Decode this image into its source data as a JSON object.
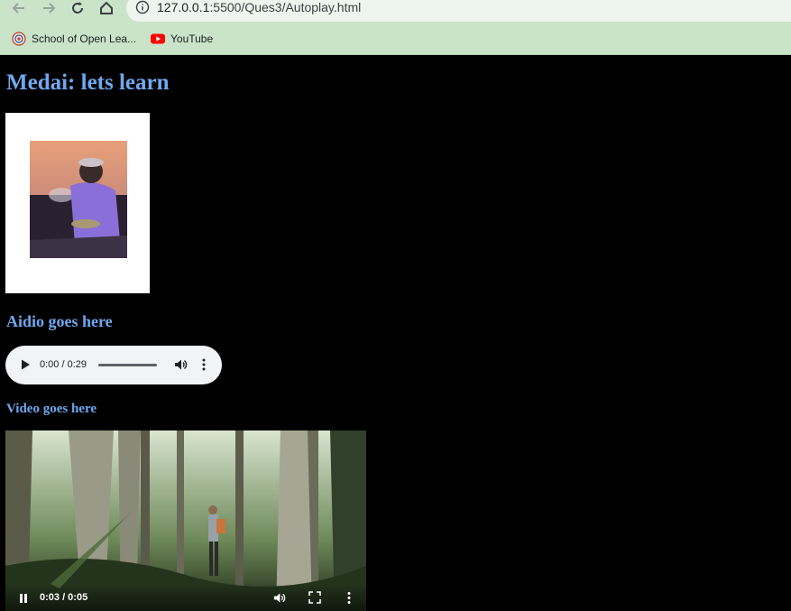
{
  "browser": {
    "url_host": "127.0.0.1",
    "url_path": ":5500/Ques3/Autoplay.html",
    "bookmarks": [
      {
        "label": "School of Open Lea...",
        "icon": "school-emblem-icon"
      },
      {
        "label": "YouTube",
        "icon": "youtube-icon"
      }
    ]
  },
  "page": {
    "heading": "Medai: lets learn",
    "audio_heading": "Aidio goes here",
    "video_heading": "Video goes here"
  },
  "audio_player": {
    "time": "0:00 / 0:29"
  },
  "video_player": {
    "time": "0:03 / 0:05",
    "state": "playing"
  },
  "colors": {
    "chrome": "#c9e4c9",
    "heading": "#6fa8ef",
    "page_bg": "#000000"
  }
}
